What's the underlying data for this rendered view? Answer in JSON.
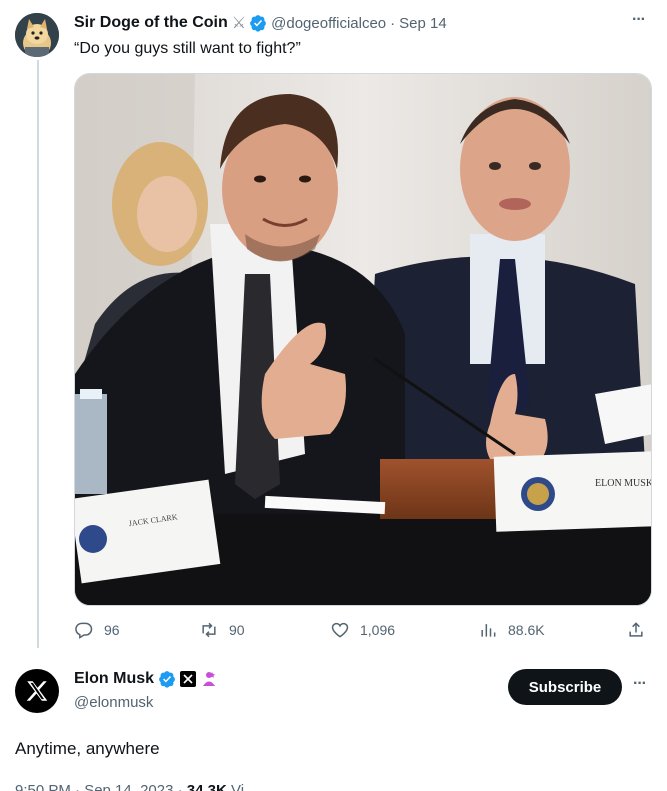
{
  "original_tweet": {
    "author_name": "Sir Doge of the Coin",
    "handle": "@dogeofficialceo",
    "separator": "·",
    "date": "Sep 14",
    "text": "“Do you guys still want to fight?”",
    "stats": {
      "replies": "96",
      "retweets": "90",
      "likes": "1,096",
      "views": "88.6K"
    }
  },
  "reply": {
    "author_name": "Elon Musk",
    "handle": "@elonmusk",
    "subscribe_label": "Subscribe",
    "text": "Anytime, anywhere",
    "meta_time": "9:50 PM · Sep 14, 2023 · ",
    "meta_views": "34.3K",
    "meta_views_label": " Vi"
  },
  "colors": {
    "verified": "#1d9bf0",
    "thread_line": "#cfd9de",
    "muted_text": "#536471",
    "accent_pink": "#c84fd8"
  },
  "icons": {
    "more": "more-horizontal-icon",
    "reply": "reply-icon",
    "retweet": "retweet-icon",
    "like": "heart-icon",
    "views": "analytics-icon",
    "share": "share-icon"
  }
}
